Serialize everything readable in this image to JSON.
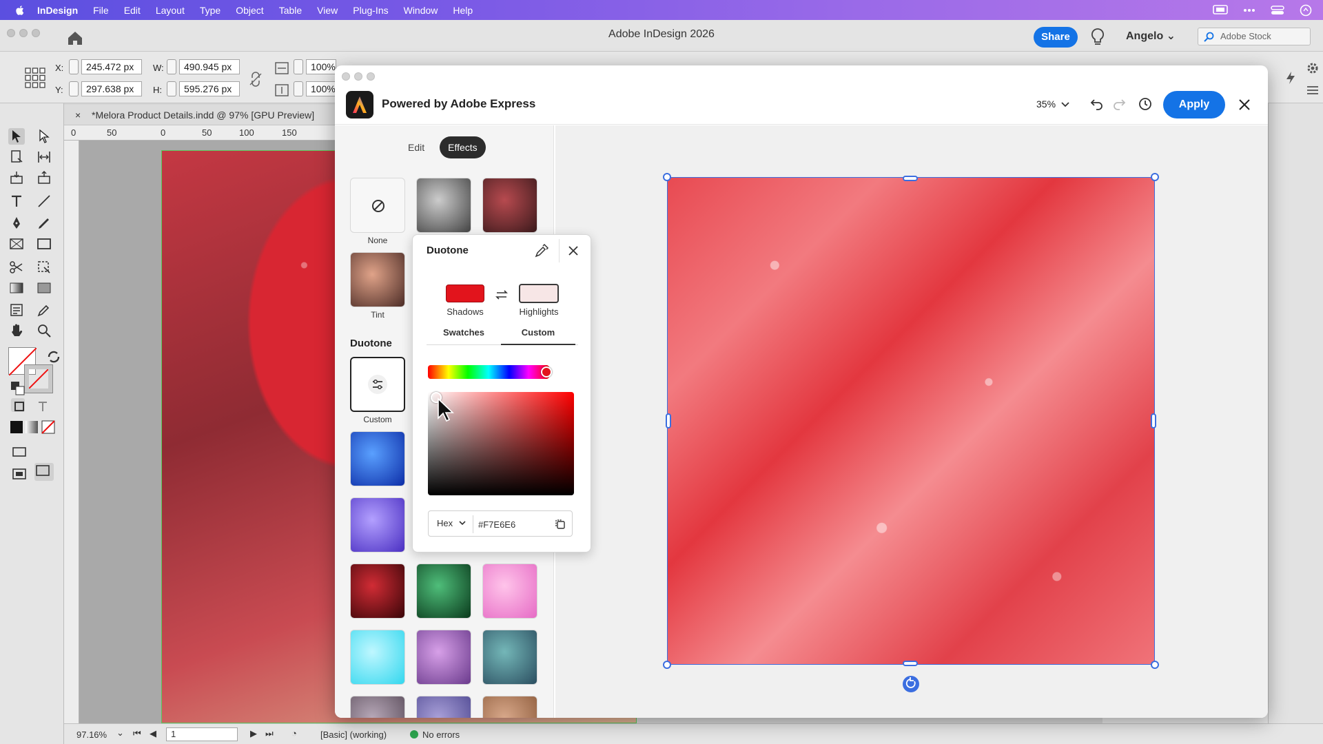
{
  "menubar": {
    "app_name": "InDesign",
    "items": [
      "File",
      "Edit",
      "Layout",
      "Type",
      "Object",
      "Table",
      "View",
      "Plug-Ins",
      "Window",
      "Help"
    ]
  },
  "window": {
    "title": "Adobe InDesign 2026",
    "share_label": "Share",
    "user_name": "Angelo",
    "stock_placeholder": "Adobe Stock"
  },
  "control_bar": {
    "x_label": "X:",
    "x_value": "245.472 px",
    "y_label": "Y:",
    "y_value": "297.638 px",
    "w_label": "W:",
    "w_value": "490.945 px",
    "h_label": "H:",
    "h_value": "595.276 px",
    "scale_x": "100%",
    "scale_y": "100%"
  },
  "document": {
    "tab_close": "×",
    "tab_title": "*Melora Product Details.indd @ 97% [GPU Preview]",
    "ruler_ticks": [
      "0",
      "50",
      "0",
      "50",
      "100",
      "150"
    ]
  },
  "statusbar": {
    "zoom": "97.16%",
    "page": "1",
    "style": "[Basic] (working)",
    "errors": "No errors"
  },
  "modal": {
    "title": "Powered by Adobe Express",
    "zoom": "35%",
    "apply_label": "Apply",
    "tabs": [
      "Edit",
      "Effects"
    ],
    "active_tab": "Effects",
    "effects": [
      {
        "label": "None"
      },
      {
        "label": "Tint"
      }
    ],
    "duotone_heading": "Duotone",
    "custom_label": "Custom",
    "duotone_popup": {
      "title": "Duotone",
      "shadows_label": "Shadows",
      "highlights_label": "Highlights",
      "shadows_color": "#E2141C",
      "highlights_color": "#F7E6E6",
      "picker_tabs": [
        "Swatches",
        "Custom"
      ],
      "active_picker_tab": "Custom",
      "format": "Hex",
      "hex_value": "#F7E6E6"
    }
  },
  "colors": {
    "accent": "#1473E6",
    "menubar_start": "#5B4FE0",
    "menubar_end": "#B778E9",
    "selection": "#3B6EE0"
  }
}
